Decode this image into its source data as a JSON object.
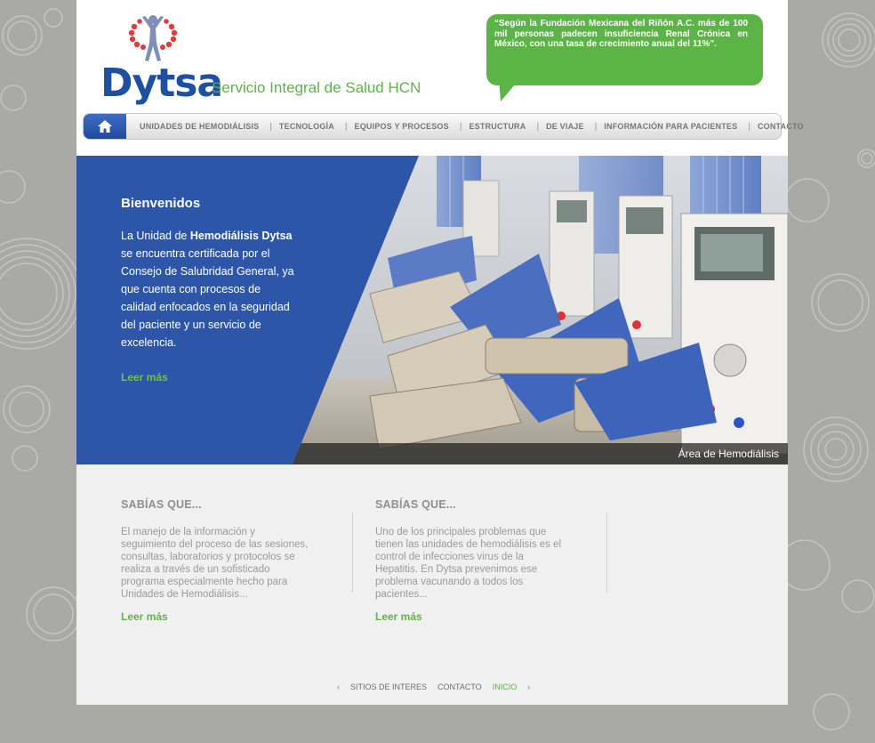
{
  "brand": {
    "name": "Dytsa",
    "tagline": "Servicio Integral de Salud HCN",
    "blue": "#1f4fa0",
    "green": "#5cb346"
  },
  "quote": "“Según la Fundación Mexicana del Riñón A.C. más de 100 mil personas padecen insuficiencia Renal Crónica en México, con una tasa de crecimiento anual del 11%”.",
  "nav": {
    "home_icon": "home-icon",
    "items": [
      "UNIDADES DE HEMODIÁLISIS",
      "TECNOLOGÍA",
      "EQUIPOS Y PROCESOS",
      "ESTRUCTURA",
      "DE VIAJE",
      "INFORMACIÓN PARA PACIENTES",
      "CONTACTO"
    ],
    "separator": "|"
  },
  "hero": {
    "title": "Bienvenidos",
    "text_pre": "La Unidad de ",
    "text_bold": "Hemodiálisis Dytsa",
    "text_post": " se encuentra certificada por el Consejo de Salubridad General, ya que cuenta con procesos de calidad enfocados en la seguridad del paciente y un servicio de excelencia.",
    "link": "Leer más",
    "caption": "Área de Hemodiálisis"
  },
  "facts": [
    {
      "title": "SABÍAS QUE...",
      "text": "El manejo de la información y seguimiento del proceso de las sesiones, consultas, laboratorios y protocolos se realiza a través de un sofisticado programa especialmente hecho para Unidades de Hemodiálisis...",
      "link": "Leer más"
    },
    {
      "title": "SABÍAS QUE...",
      "text": "Uno de los principales problemas que tienen las unidades de hemodiálisis es el control de infecciones virus de la Hepatitis. En Dytsa prevenimos ese problema vacunando a todos los pacientes...",
      "link": "Leer más"
    }
  ],
  "footer": {
    "prev": "‹",
    "next": "›",
    "items": [
      "SITIOS DE INTERES",
      "CONTACTO",
      "INICIO"
    ],
    "active": "INICIO"
  }
}
